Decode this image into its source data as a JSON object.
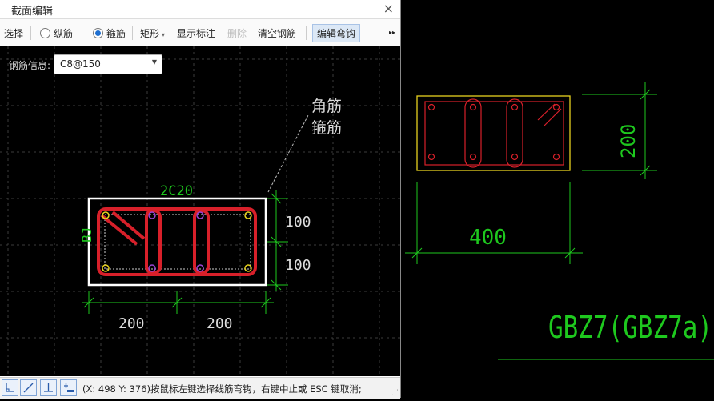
{
  "window": {
    "title": "截面编辑",
    "close_icon": "×"
  },
  "toolbar": {
    "select_label": "选择",
    "longitudinal_label": "纵筋",
    "stirrup_label": "箍筋",
    "shape_label": "矩形",
    "show_annotation_label": "显示标注",
    "delete_label": "删除",
    "clear_rebar_label": "清空钢筋",
    "edit_hook_label": "编辑弯钩",
    "more_label": "▸▸",
    "selected_mode": "箍筋"
  },
  "rebar_info": {
    "label": "钢筋信息:",
    "value": "C8@150"
  },
  "drawing": {
    "top_rebar": "2C20",
    "side_label": "BJ",
    "leader_line1": "角筋",
    "leader_line2": "箍筋",
    "dim_right_top": "100",
    "dim_right_bottom": "100",
    "dim_bottom_left": "200",
    "dim_bottom_right": "200"
  },
  "preview": {
    "dim_height": "200",
    "dim_width": "400",
    "component_name": "GBZ7(GBZ7a)"
  },
  "statusbar": {
    "text": "(X: 498 Y: 376)按鼠标左键选择线筋弯钩，右键中止或 ESC 键取消;"
  },
  "colors": {
    "rebar": "#d8202a",
    "dimension": "#1ec81e",
    "outline": "#ffffff",
    "preview_outline": "#e6d21e"
  }
}
